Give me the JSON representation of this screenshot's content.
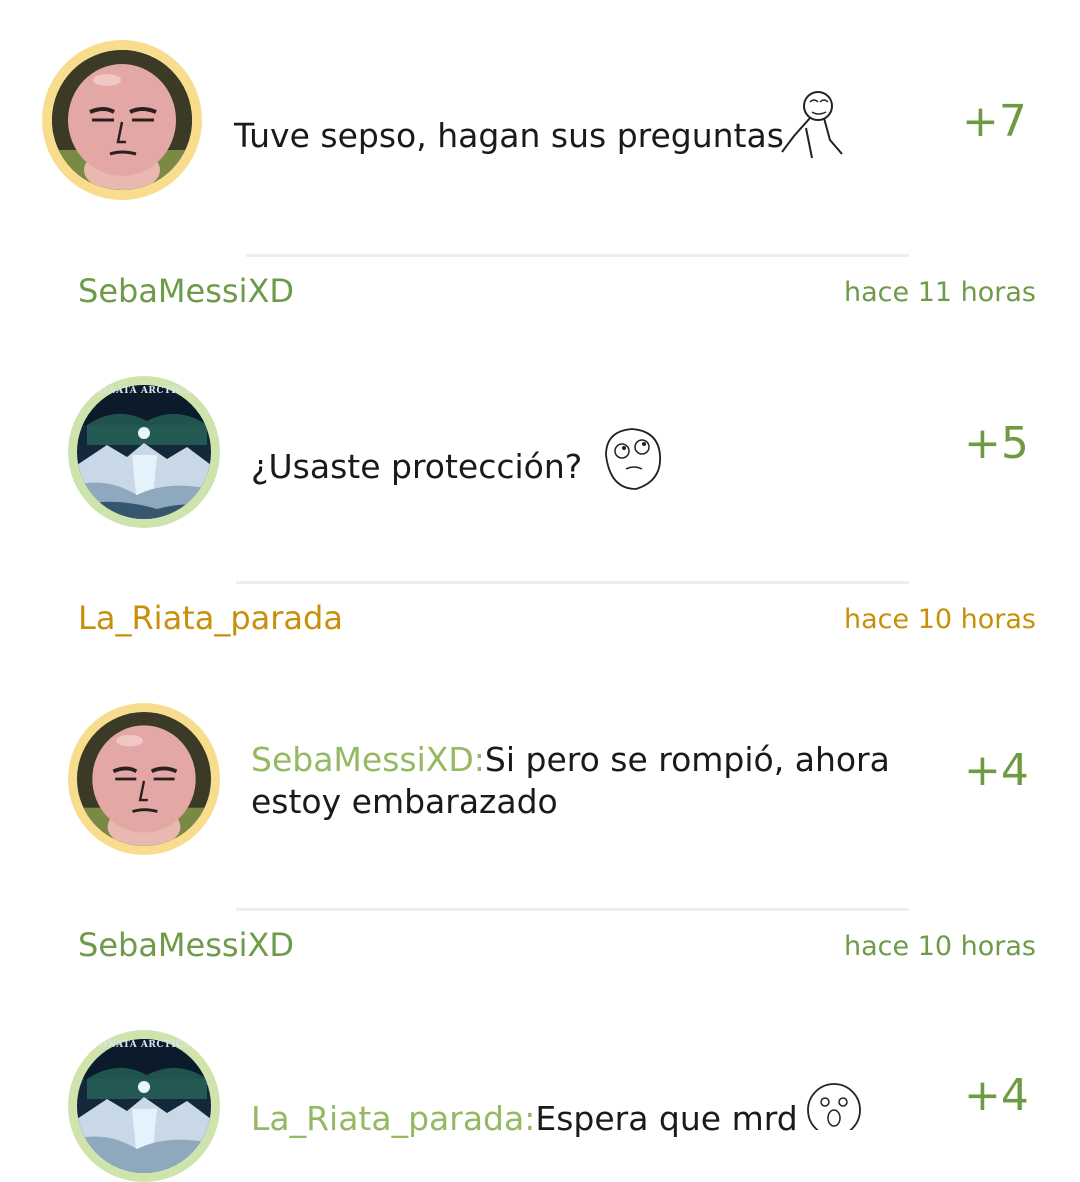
{
  "colors": {
    "accent_green": "#6f9a44",
    "mention_green": "#95b963",
    "user_gold": "#c8900a",
    "avatar_ring_gold": "#f9dd8f",
    "avatar_ring_green": "#cfe3ad"
  },
  "comments": [
    {
      "avatar": "bald-face-avatar",
      "text": "Tuve sepso, hagan sus preguntas",
      "emoji": "fuck-yea-rage-face-icon",
      "score": "+7",
      "footer_user": "SebaMessiXD",
      "footer_time": "hace 11 horas"
    },
    {
      "avatar": "sonata-arctica-album-avatar",
      "text": "¿Usaste protección?",
      "emoji": "wondering-rage-face-icon",
      "score": "+5",
      "footer_user": "La_Riata_parada",
      "footer_time": "hace 10 horas"
    },
    {
      "avatar": "bald-face-avatar",
      "mention": "SebaMessiXD:",
      "text_line1": "Si pero se rompió, ahora",
      "text_line2": "estoy embarazado",
      "score": "+4",
      "footer_user": "SebaMessiXD",
      "footer_time": "hace 10 horas"
    },
    {
      "avatar": "sonata-arctica-album-avatar",
      "mention": "La_Riata_parada:",
      "text": "Espera que mrd",
      "emoji": "shocked-rage-face-icon",
      "score": "+4"
    }
  ]
}
